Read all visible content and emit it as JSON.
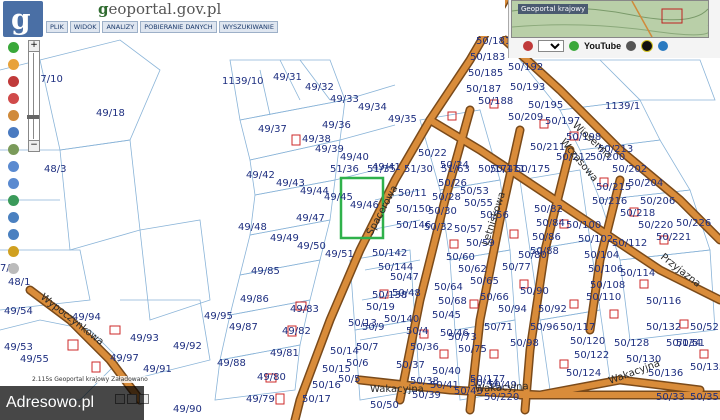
{
  "app": {
    "brand_prefix": "g",
    "brand_rest": "eoportal.gov.pl",
    "logo_letter": "g",
    "menu": [
      "PLIK",
      "WIDOK",
      "ANALIZY",
      "POBIERANIE DANYCH",
      "WYSZUKIWANIE"
    ],
    "overview_title": "Geoportal krajowy",
    "language": "pol",
    "youtube_label": "YouTube"
  },
  "status": {
    "time": "2.115s",
    "service": "Geoportal krajowy",
    "state": "Załadowano"
  },
  "watermark": "Adresowo.pl",
  "colors": {
    "road": "#d98c3a",
    "road_edge": "#7a4a1a",
    "parcel_line": "#8ab4d8",
    "label": "#1e2f80",
    "highlight": "#2fb14b",
    "buildings": "#cc2a2a"
  },
  "streets": [
    "Wypoczynkowa",
    "Wakacyjna",
    "Wakacyjna",
    "Wakacyjna",
    "Wczasowa",
    "Letniskowa",
    "Spacerowa",
    "Wiosenna",
    "Przyjazna"
  ],
  "parcels": [
    "47/10",
    "49/18",
    "48/3",
    "1139/10",
    "49/31",
    "49/32",
    "49/33",
    "49/34",
    "49/35",
    "49/37",
    "49/36",
    "49/38",
    "49/39",
    "49/40",
    "49/41",
    "49/42",
    "49/43",
    "49/44",
    "49/45",
    "49/46",
    "49/47",
    "49/48",
    "49/49",
    "49/50",
    "49/51",
    "49/85",
    "49/86",
    "49/87",
    "49/88",
    "49/95",
    "49/83",
    "49/82",
    "49/81",
    "49/80",
    "49/79",
    "49/54",
    "49/53",
    "49/55",
    "49/94",
    "49/93",
    "49/92",
    "49/91",
    "49/97",
    "49/90",
    "48/1",
    "7/1",
    "1139/1",
    "50/171",
    "50/181",
    "50/183",
    "50/185",
    "50/187",
    "50/188",
    "50/192",
    "50/193",
    "50/195",
    "50/197",
    "50/198",
    "50/200",
    "50/202",
    "50/204",
    "50/206",
    "50/209",
    "50/211",
    "50/212",
    "50/213",
    "50/215",
    "50/216",
    "50/218",
    "50/220",
    "50/221",
    "50/226",
    "50/22",
    "50/24",
    "50/26",
    "50/28",
    "50/30",
    "50/32",
    "50/53",
    "50/55",
    "50/56",
    "50/57",
    "50/59",
    "50/60",
    "50/62",
    "50/64",
    "50/65",
    "50/66",
    "50/68",
    "50/71",
    "50/73",
    "50/75",
    "50/77",
    "50/80",
    "50/82",
    "50/84",
    "50/86",
    "50/88",
    "50/90",
    "50/92",
    "50/94",
    "50/96",
    "50/98",
    "50/100",
    "50/102",
    "50/104",
    "50/106",
    "50/108",
    "50/110",
    "50/112",
    "50/114",
    "50/116",
    "50/117",
    "50/120",
    "50/122",
    "50/124",
    "50/128",
    "50/130",
    "50/132",
    "50/134",
    "50/135",
    "50/136",
    "50/138",
    "50/140",
    "50/142",
    "50/144",
    "50/146",
    "50/150",
    "50/11",
    "50/13",
    "50/14",
    "50/15",
    "50/16",
    "50/17",
    "50/19",
    "50/9",
    "50/7",
    "50/6",
    "50/5",
    "50/4",
    "50/36",
    "50/37",
    "50/38",
    "50/39",
    "50/40",
    "50/41",
    "50/43",
    "50/44",
    "50/45",
    "50/46",
    "50/47",
    "50/48",
    "50/49",
    "50/50",
    "50/51",
    "50/52",
    "50/33",
    "50/35",
    "50/177",
    "50/220",
    "51/36",
    "51/35",
    "51/30",
    "51/63",
    "50/174",
    "50/175"
  ]
}
